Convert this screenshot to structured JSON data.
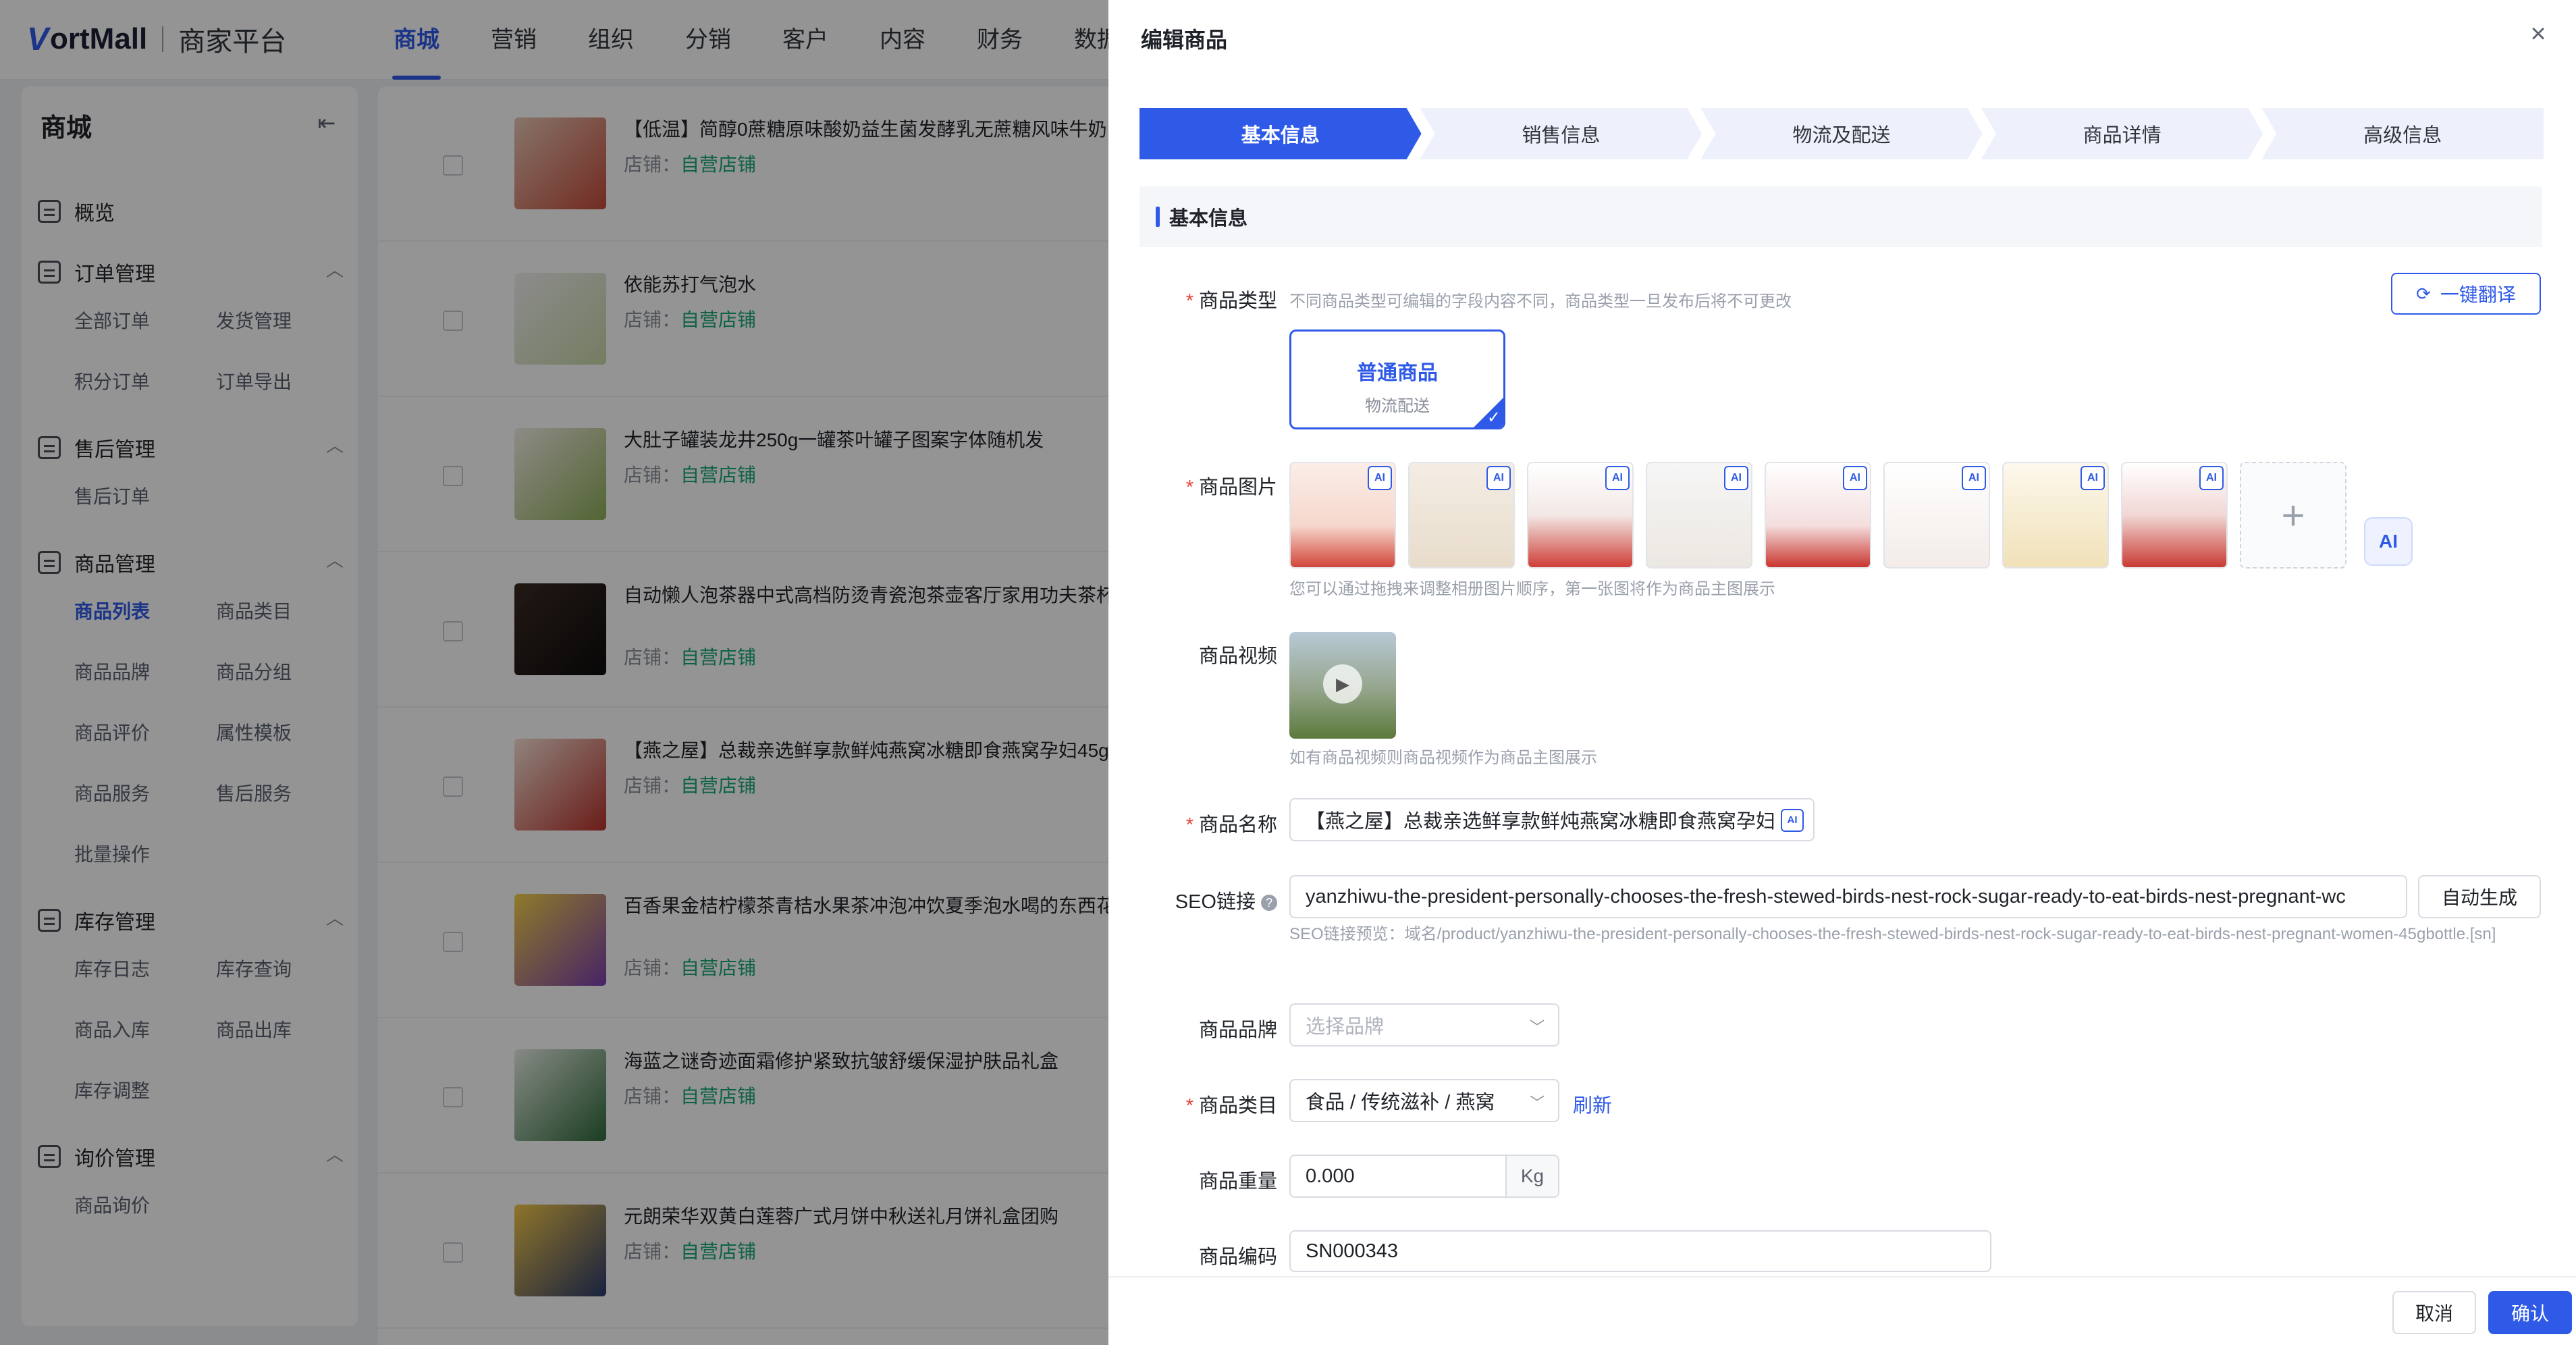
{
  "app": {
    "logo": "ortMall",
    "platform": "商家平台"
  },
  "nav": [
    "商城",
    "营销",
    "组织",
    "分销",
    "客户",
    "内容",
    "财务",
    "数据"
  ],
  "sidebar": {
    "title": "商城",
    "overview": "概览",
    "groups": {
      "order": {
        "label": "订单管理",
        "items": [
          "全部订单",
          "发货管理",
          "积分订单",
          "订单导出"
        ]
      },
      "aftersale": {
        "label": "售后管理",
        "items": [
          "售后订单"
        ]
      },
      "product": {
        "label": "商品管理",
        "items": [
          "商品列表",
          "商品类目",
          "商品品牌",
          "商品分组",
          "商品评价",
          "属性模板",
          "商品服务",
          "售后服务",
          "批量操作"
        ]
      },
      "stock": {
        "label": "库存管理",
        "items": [
          "库存日志",
          "库存查询",
          "商品入库",
          "商品出库",
          "库存调整"
        ]
      },
      "inquiry": {
        "label": "询价管理",
        "items": [
          "商品询价"
        ]
      }
    }
  },
  "list": {
    "store_prefix": "店铺：",
    "rows": [
      {
        "name": "【低温】简醇0蔗糖原味酸奶益生菌发酵乳无蔗糖风味牛奶",
        "store": "自营店铺"
      },
      {
        "name": "依能苏打气泡水",
        "store": "自营店铺"
      },
      {
        "name": "大肚子罐装龙井250g一罐茶叶罐子图案字体随机发",
        "store": "自营店铺"
      },
      {
        "name": "自动懒人泡茶器中式高档防烫青瓷泡茶壶客厅家用功夫茶杯品",
        "store": "自营店铺"
      },
      {
        "name": "【燕之屋】总裁亲选鲜享款鲜炖燕窝冰糖即食燕窝孕妇45g",
        "store": "自营店铺"
      },
      {
        "name": "百香果金桔柠檬茶青桔水果茶冲泡冲饮夏季泡水喝的东西花包",
        "store": "自营店铺"
      },
      {
        "name": "海蓝之谜奇迹面霜修护紧致抗皱舒缓保湿护肤品礼盒",
        "store": "自营店铺"
      },
      {
        "name": "元朗荣华双黄白莲蓉广式月饼中秋送礼月饼礼盒团购",
        "store": "自营店铺"
      }
    ]
  },
  "drawer": {
    "title": "编辑商品",
    "steps": [
      "基本信息",
      "销售信息",
      "物流及配送",
      "商品详情",
      "高级信息"
    ],
    "section_title": "基本信息",
    "type": {
      "label": "商品类型",
      "hint": "不同商品类型可编辑的字段内容不同，商品类型一旦发布后将不可更改",
      "card_title": "普通商品",
      "card_sub": "物流配送",
      "translate_btn": "一键翻译"
    },
    "images": {
      "label": "商品图片",
      "hint": "您可以通过拖拽来调整相册图片顺序，第一张图将作为商品主图展示",
      "count": 8
    },
    "video": {
      "label": "商品视频",
      "hint": "如有商品视频则商品视频作为商品主图展示"
    },
    "name": {
      "label": "商品名称",
      "value": "【燕之屋】总裁亲选鲜享款鲜炖燕窝冰糖即食燕窝孕妇"
    },
    "seo": {
      "label": "SEO链接",
      "value": "yanzhiwu-the-president-personally-chooses-the-fresh-stewed-birds-nest-rock-sugar-ready-to-eat-birds-nest-pregnant-wc",
      "preview": "SEO链接预览：域名/product/yanzhiwu-the-president-personally-chooses-the-fresh-stewed-birds-nest-rock-sugar-ready-to-eat-birds-nest-pregnant-women-45gbottle.[sn]",
      "auto_btn": "自动生成"
    },
    "brand": {
      "label": "商品品牌",
      "placeholder": "选择品牌"
    },
    "category": {
      "label": "商品类目",
      "value": "食品 / 传统滋补 / 燕窝",
      "refresh": "刷新"
    },
    "weight": {
      "label": "商品重量",
      "value": "0.000",
      "unit": "Kg"
    },
    "code": {
      "label": "商品编码",
      "value": "SN000343"
    },
    "cancel": "取消",
    "confirm": "确认"
  },
  "colors": {
    "accent": "#2f5ae8",
    "store": "#19a974",
    "required": "#e8443a"
  }
}
